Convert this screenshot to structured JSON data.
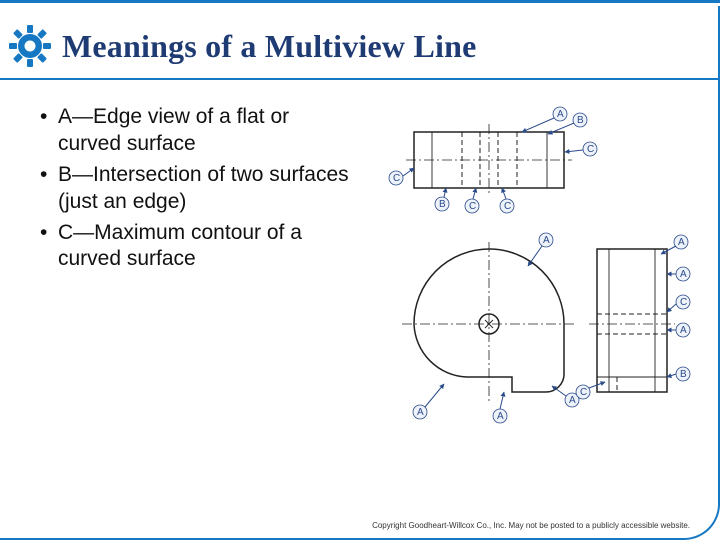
{
  "title": "Meanings of a Multiview Line",
  "bullets": [
    "A—Edge view of a flat or curved surface",
    "B—Intersection of two surfaces (just an edge)",
    "C—Maximum contour of a curved surface"
  ],
  "labels": {
    "a": "A",
    "b": "B",
    "c": "C"
  },
  "copyright": "Copyright Goodheart-Willcox Co., Inc. May not be posted to a publicly accessible website."
}
